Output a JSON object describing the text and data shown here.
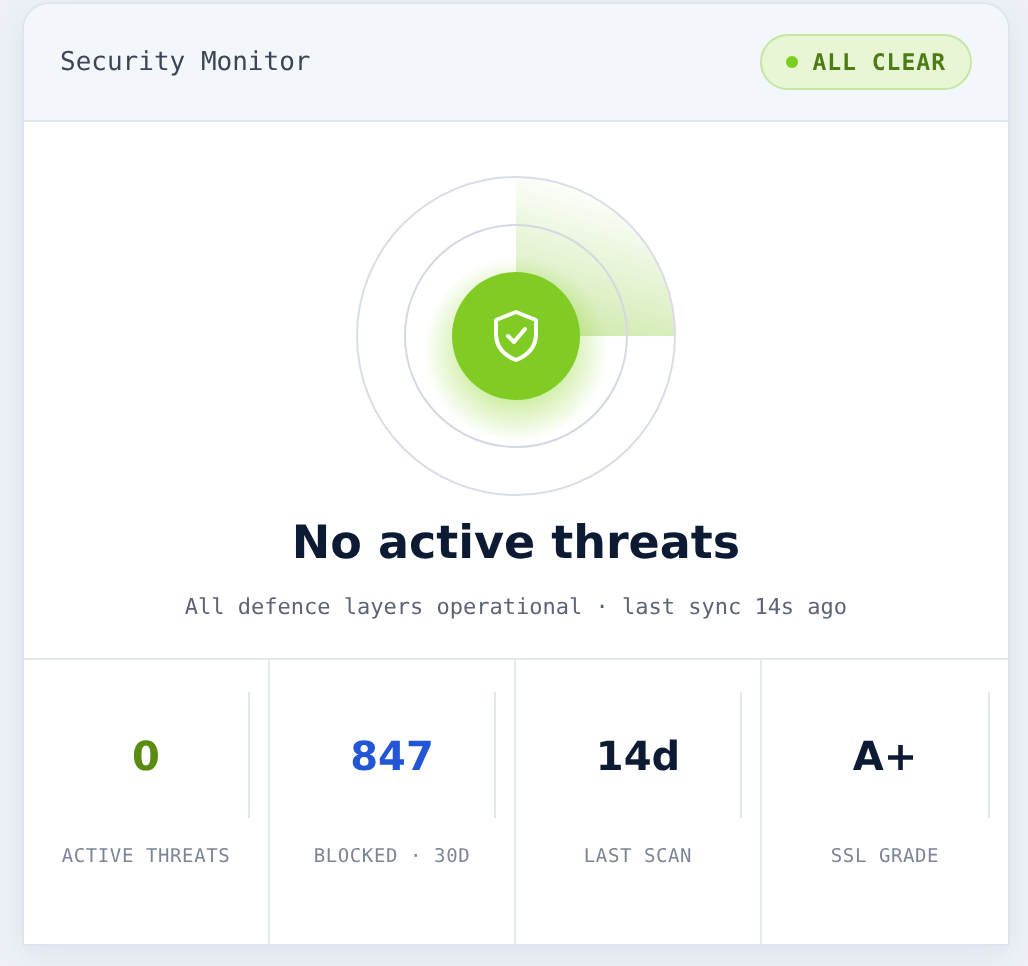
{
  "header": {
    "title": "Security Monitor",
    "status": {
      "label": "ALL CLEAR",
      "color": "#7ccf1f"
    }
  },
  "summary": {
    "headline": "No active threats",
    "detail": "All defence layers operational · last sync 14s ago"
  },
  "stats": [
    {
      "value": "0",
      "label": "ACTIVE THREATS",
      "color": "#5b8c12"
    },
    {
      "value": "847",
      "label": "BLOCKED · 30D",
      "color": "#2356d6"
    },
    {
      "value": "14d",
      "label": "LAST SCAN",
      "color": "#0d1a33"
    },
    {
      "value": "A+",
      "label": "SSL GRADE",
      "color": "#0d1a33"
    }
  ]
}
